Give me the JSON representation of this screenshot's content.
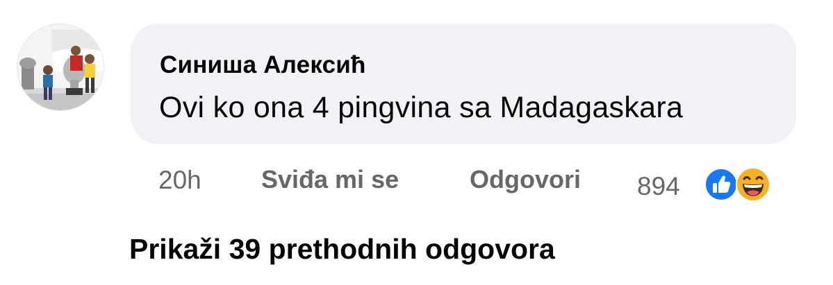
{
  "comment": {
    "author": "Синиша Алексић",
    "text": "Ovi ko ona 4 pingvina sa Madagaskara",
    "avatar_icon": "profile-photo"
  },
  "meta": {
    "timestamp": "20h",
    "like_label": "Sviđa mi se",
    "reply_label": "Odgovori",
    "reaction_count": "894",
    "reactions": [
      "like-icon",
      "haha-icon"
    ]
  },
  "replies": {
    "view_label": "Prikaži 39 prethodnih odgovora"
  },
  "colors": {
    "bubble": "#f0f2f5",
    "text_primary": "#050505",
    "text_secondary": "#65676b",
    "like_blue": "#1877f2",
    "haha_yellow": "#f7b125"
  }
}
